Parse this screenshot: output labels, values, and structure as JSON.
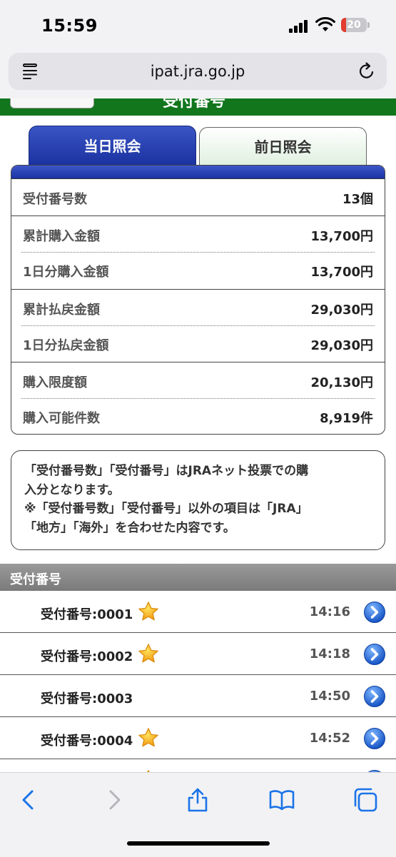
{
  "status_bar": {
    "time": "15:59",
    "battery": "20",
    "battery_level": 0.2
  },
  "browser": {
    "url": "ipat.jra.go.jp"
  },
  "header": {
    "title": "受付番号"
  },
  "tabs": [
    {
      "label": "当日照会",
      "active": true
    },
    {
      "label": "前日照会",
      "active": false
    }
  ],
  "summary": [
    {
      "label": "受付番号数",
      "value": "13個"
    },
    {
      "label": "累計購入金額",
      "value": "13,700円"
    },
    {
      "label": "1日分購入金額",
      "value": "13,700円"
    },
    {
      "label": "累計払戻金額",
      "value": "29,030円"
    },
    {
      "label": "1日分払戻金額",
      "value": "29,030円"
    },
    {
      "label": "購入限度額",
      "value": "20,130円"
    },
    {
      "label": "購入可能件数",
      "value": "8,919件"
    }
  ],
  "note": {
    "line1": "「受付番号数」「受付番号」はJRAネット投票での購",
    "line2": "入分となります。",
    "line3": "※「受付番号数」「受付番号」以外の項目は「JRA」",
    "line4": "「地方」「海外」を合わせた内容です。"
  },
  "list_header": "受付番号",
  "receipts": [
    {
      "number": "受付番号:0001",
      "time": "14:16",
      "starred": true
    },
    {
      "number": "受付番号:0002",
      "time": "14:18",
      "starred": true
    },
    {
      "number": "受付番号:0003",
      "time": "14:50",
      "starred": false
    },
    {
      "number": "受付番号:0004",
      "time": "14:52",
      "starred": true
    },
    {
      "number": "",
      "time": "",
      "starred": true
    }
  ],
  "colors": {
    "jra_green": "#11761c",
    "tab_blue": "#1b31a0",
    "star_gold": "#f4a81c",
    "arrow_blue": "#1f6fd6",
    "ios_blue": "#1a73e8"
  },
  "icons": {
    "reader": "reader-icon",
    "reload": "reload-icon",
    "star": "star-icon",
    "arrow": "chevron-right-circle-icon",
    "back": "chevron-left-icon",
    "forward": "chevron-right-icon",
    "share": "share-icon",
    "bookmarks": "book-icon",
    "tabs": "tabs-icon"
  }
}
